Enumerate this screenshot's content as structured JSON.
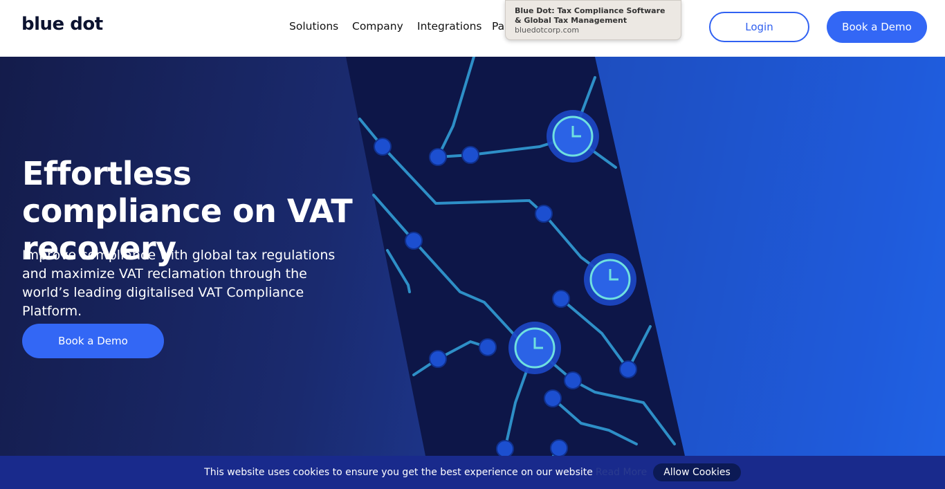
{
  "header": {
    "logo_text": "blue dot",
    "nav": [
      "Solutions",
      "Company",
      "Integrations",
      "Pa"
    ],
    "login_label": "Login",
    "demo_label": "Book a Demo"
  },
  "tooltip": {
    "title": "Blue Dot: Tax Compliance Software & Global Tax Management",
    "url": "bluedotcorp.com"
  },
  "hero": {
    "headline": "Effortless compliance on VAT recovery",
    "subtext": "Improve compliance with global tax regulations and maximize VAT reclamation through the world’s leading digitalised VAT Compliance Platform.",
    "cta_label": "Book a Demo"
  },
  "cookie_banner": {
    "text": "This website uses cookies to ensure you get the best experience on our website",
    "read_more": "Read More",
    "allow_label": "Allow Cookies"
  },
  "colors": {
    "accent": "#3367f5",
    "dark_navy": "#141c4b",
    "cookie_bar": "#192a8c"
  }
}
